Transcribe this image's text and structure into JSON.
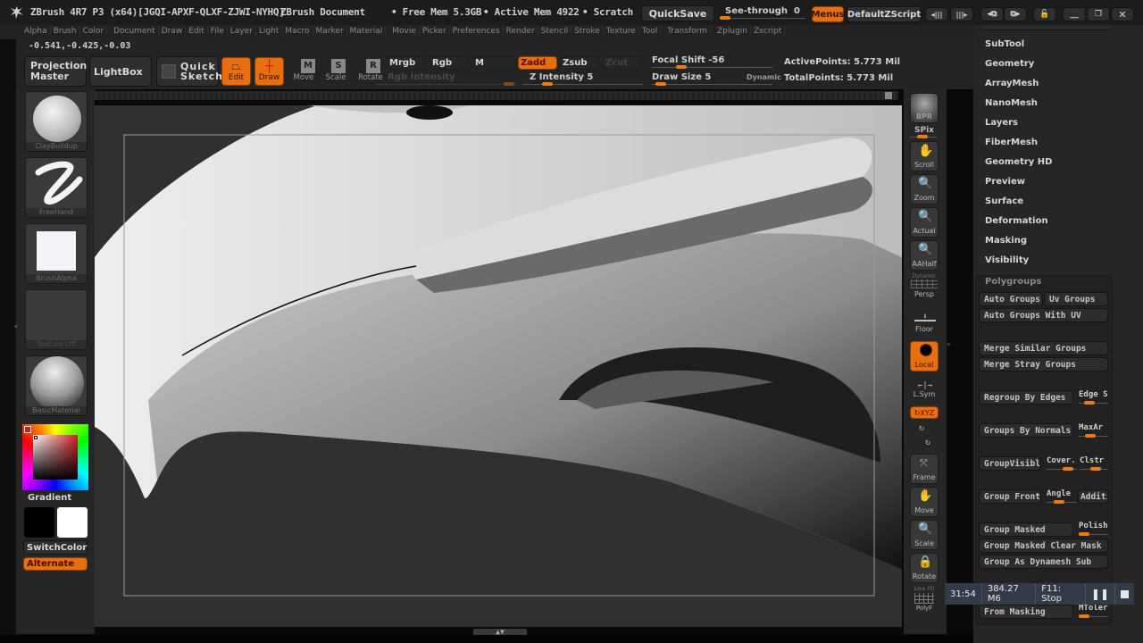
{
  "titlebar": {
    "app_title": "ZBrush 4R7 P3 (x64)[JGQI-APXF-QLXF-ZJWI-NYHQ]",
    "document": "ZBrush Document",
    "free_mem": "• Free Mem 5.3GB",
    "active_mem": "• Active Mem 4922",
    "scratch": "• Scratch D",
    "quicksave": "QuickSave",
    "see_through_label": "See-through",
    "see_through_value": "0",
    "see_through_fraction": 0.0,
    "menus": "Menus",
    "default_zscript": "DefaultZScript"
  },
  "menubar": {
    "items": [
      "Alpha",
      "Brush",
      "Color",
      "Document",
      "Draw",
      "Edit",
      "File",
      "Layer",
      "Light",
      "Macro",
      "Marker",
      "Material",
      "Movie",
      "Picker",
      "Preferences",
      "Render",
      "Stencil",
      "Stroke",
      "Texture",
      "Tool",
      "Transform",
      "Zplugin",
      "Zscript"
    ]
  },
  "coordinates": "-0.541,-0.425,-0.03",
  "toolbar": {
    "projection_master": "Projection Master",
    "lightbox": "LightBox",
    "quick_sketch": "Quick Sketch",
    "edit": "Edit",
    "draw": "Draw",
    "move": "Move",
    "scale": "Scale",
    "rotate": "Rotate",
    "move_key": "M",
    "scale_key": "S",
    "rotate_key": "R",
    "mrgb": "Mrgb",
    "rgb": "Rgb",
    "m": "M",
    "zadd": "Zadd",
    "zsub": "Zsub",
    "zcut": "Zcut",
    "rgb_intensity": "Rgb Intensity",
    "z_intensity": "Z Intensity 5",
    "focal_shift": "Focal Shift -56",
    "draw_size": "Draw Size 5",
    "dynamic": "Dynamic",
    "active_points": "ActivePoints: 5.773 Mil",
    "total_points": "TotalPoints: 5.773 Mil"
  },
  "left_panel": {
    "brush": "ClayBuildup",
    "stroke": "FreeHand",
    "alpha": "BrushAlpha",
    "texture": "Texture Off",
    "material": "BasicMaterial",
    "gradient": "Gradient",
    "switch_color": "SwitchColor",
    "alternate": "Alternate",
    "main_color": "#000000",
    "secondary_color": "#ffffff",
    "picker_color": "#d21e28"
  },
  "right_shelf": {
    "bpr": "BPR",
    "spix": "SPix",
    "scroll": "Scroll",
    "zoom": "Zoom",
    "actual": "Actual",
    "aahalf": "AAHalf",
    "dynamic": "Dynamic",
    "persp": "Persp",
    "floor": "Floor",
    "local": "Local",
    "lsym": "L.Sym",
    "xyz": "XYZ",
    "frame": "Frame",
    "move": "Move",
    "scale": "Scale",
    "rotate": "Rotate",
    "line_fill": "Line Fill",
    "polyf": "PolyF"
  },
  "tray": {
    "items": [
      "SubTool",
      "Geometry",
      "ArrayMesh",
      "NanoMesh",
      "Layers",
      "FiberMesh",
      "Geometry HD",
      "Preview",
      "Surface",
      "Deformation",
      "Masking",
      "Visibility"
    ],
    "polygroups": {
      "title": "Polygroups",
      "auto_groups": "Auto Groups",
      "uv_groups": "Uv Groups",
      "auto_groups_uv": "Auto Groups With UV",
      "merge_similar": "Merge Similar Groups",
      "merge_stray": "Merge Stray Groups",
      "regroup_edges": "Regroup By Edges",
      "edge_slider": "Edge S",
      "groups_normals": "Groups By Normals",
      "maxar_slider": "MaxAr",
      "group_visible": "GroupVisible",
      "cover_slider": "Cover.",
      "clstr_slider": "Clstr",
      "group_front": "Group Front",
      "angle_slider": "Angle",
      "additi": "Additi",
      "group_masked": "Group Masked",
      "polish_slider": "Polish",
      "group_masked_clear": "Group Masked Clear Mask",
      "group_dynamesh": "Group As Dynamesh Sub",
      "from_masking": "From Masking",
      "mtoler_slider": "MToler"
    }
  },
  "recorder": {
    "time": "31:54",
    "size": "384.27 M6",
    "stop": "F11: Stop"
  }
}
